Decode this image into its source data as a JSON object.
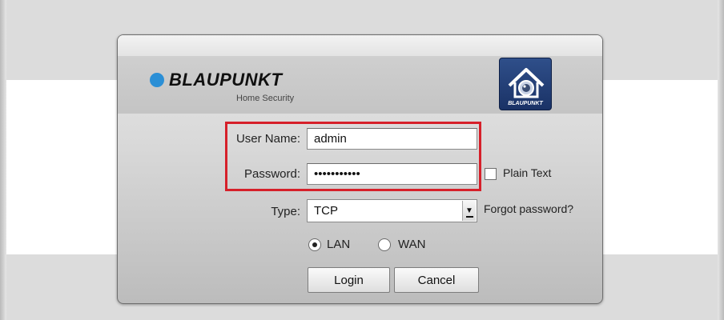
{
  "brand": {
    "name": "BLAUPUNKT",
    "subtitle": "Home Security",
    "app_icon_label": "BLAUPUNKT",
    "accent_color": "#2b8fd6"
  },
  "form": {
    "username_label": "User Name:",
    "username_value": "admin",
    "password_label": "Password:",
    "password_value": "•••••••••••",
    "plain_text_label": "Plain Text",
    "plain_text_checked": false,
    "type_label": "Type:",
    "type_value": "TCP",
    "forgot_password_label": "Forgot password?",
    "network_options": [
      {
        "label": "LAN",
        "selected": true
      },
      {
        "label": "WAN",
        "selected": false
      }
    ],
    "highlight_color": "#d6202a"
  },
  "buttons": {
    "login_label": "Login",
    "cancel_label": "Cancel"
  },
  "icons": [
    "home-camera-icon",
    "chevron-down-icon"
  ]
}
